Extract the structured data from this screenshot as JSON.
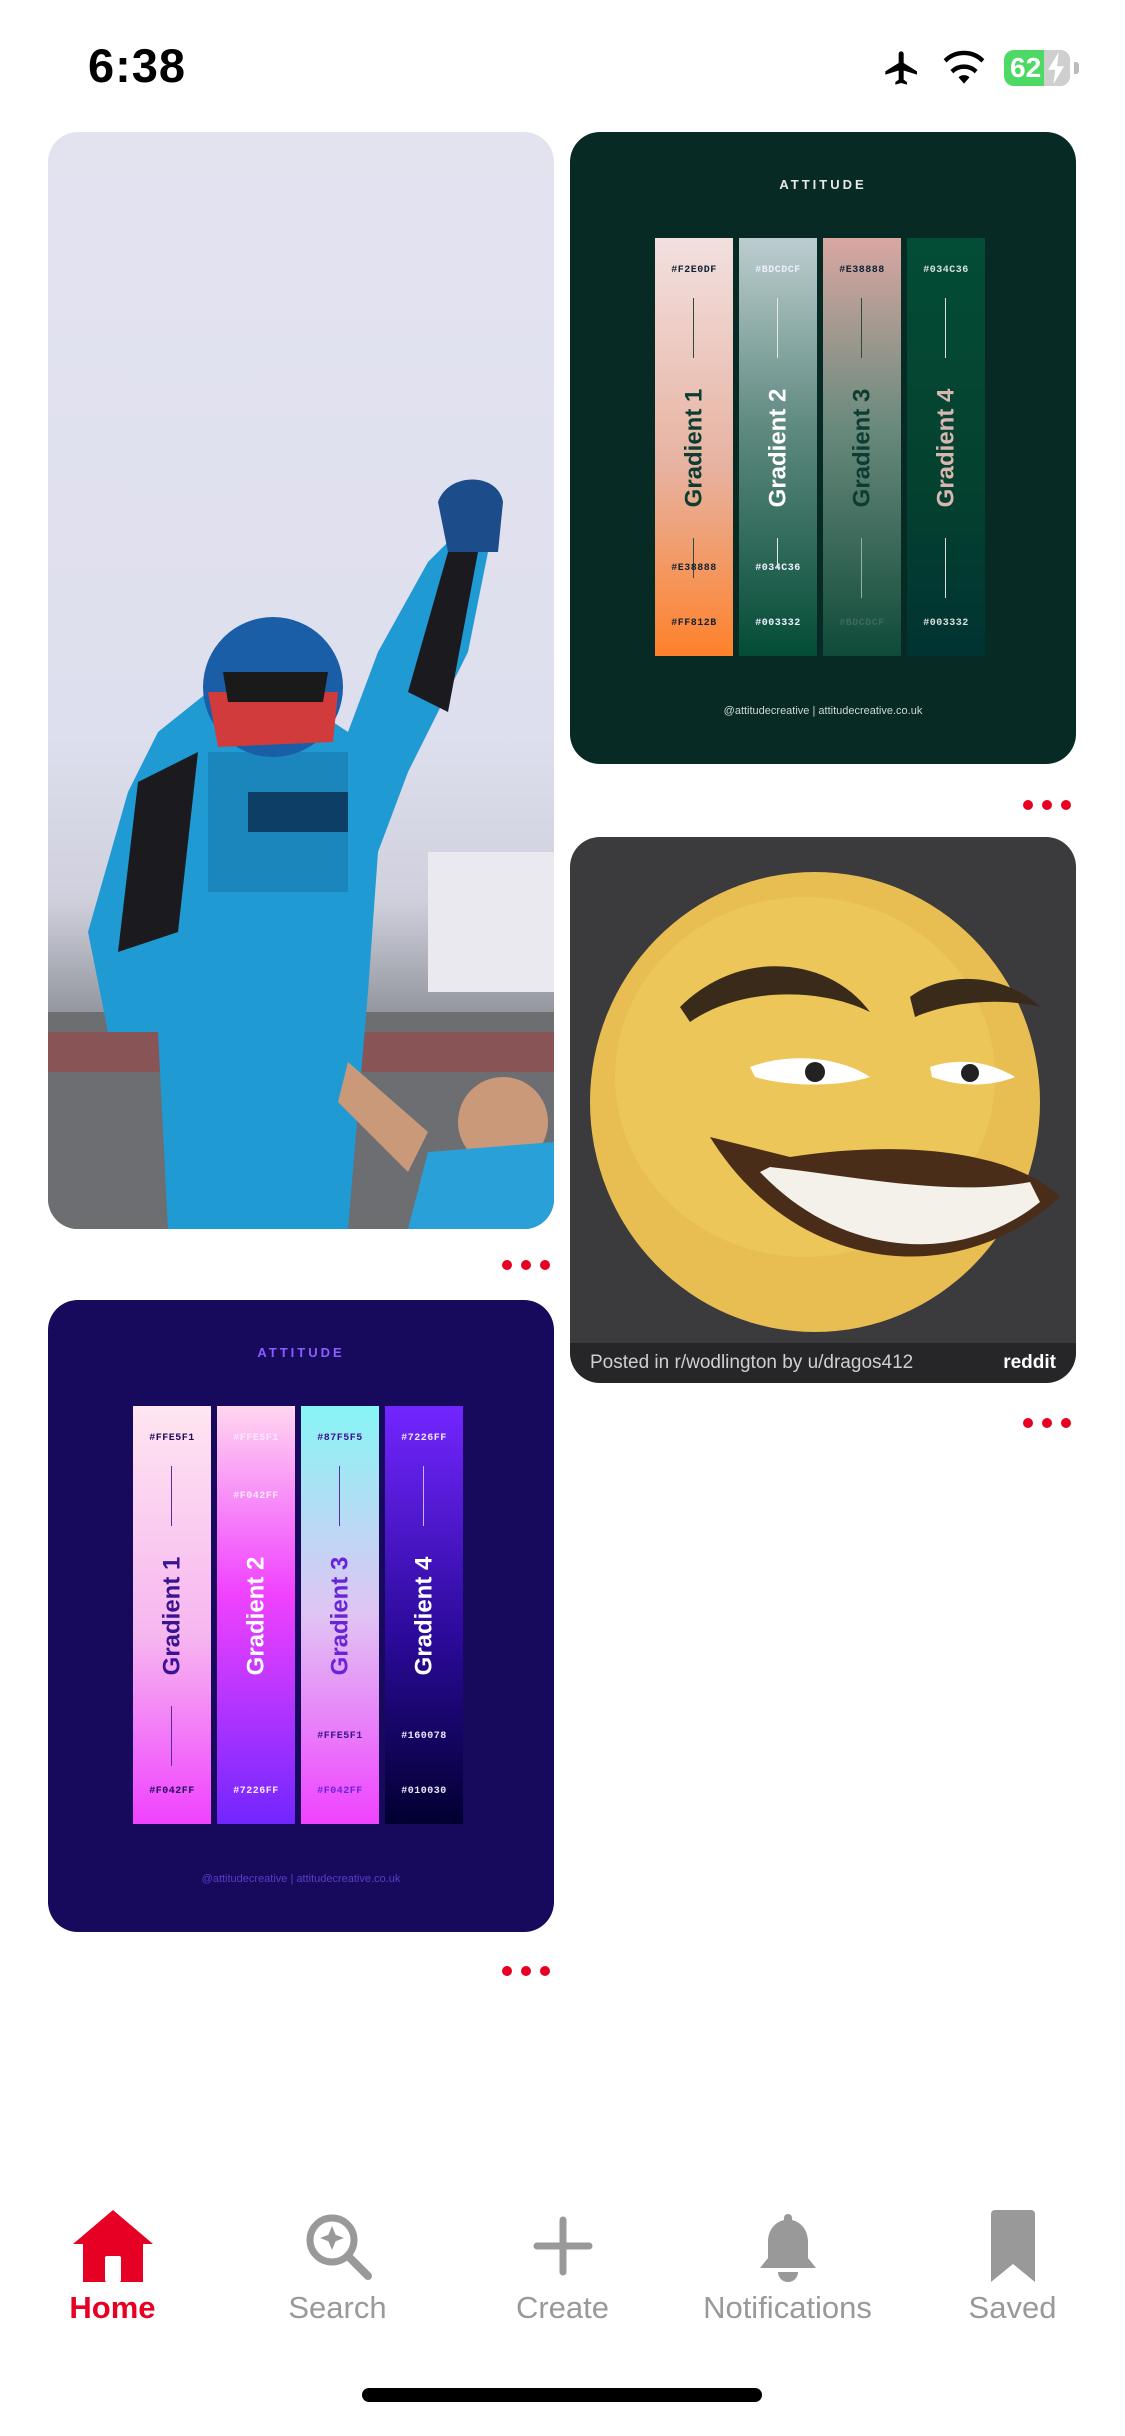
{
  "status_bar": {
    "time": "6:38",
    "battery": "62"
  },
  "pins": {
    "racer": {
      "alt": "Racing driver celebrating"
    },
    "palette_green": {
      "brand": "ATTITUDE",
      "footer": "@attitudecreative | attitudecreative.co.uk",
      "strips": [
        {
          "name": "Gradient 1",
          "top_hex": "#F2E0DF",
          "mid_hex": "#E38888",
          "bottom_hex": "#FF812B"
        },
        {
          "name": "Gradient 2",
          "top_hex": "#BDCDCF",
          "mid_hex": "#034C36",
          "bottom_hex": "#003332"
        },
        {
          "name": "Gradient 3",
          "top_hex": "#E38888",
          "mid_hex": "",
          "bottom_hex": "#BDCDCF"
        },
        {
          "name": "Gradient 4",
          "top_hex": "#034C36",
          "mid_hex": "",
          "bottom_hex": "#003332"
        }
      ]
    },
    "meme": {
      "caption_left": "Posted in r/wodlington by u/dragos412",
      "caption_right": "reddit"
    },
    "palette_purple": {
      "brand": "ATTITUDE",
      "footer": "@attitudecreative | attitudecreative.co.uk",
      "strips": [
        {
          "name": "Gradient 1",
          "top_hex": "#FFE5F1",
          "mid_hex": "",
          "bottom_hex": "#F042FF"
        },
        {
          "name": "Gradient 2",
          "top_hex": "#FFE5F1",
          "mid_hex": "#F042FF",
          "bottom_hex": "#7226FF"
        },
        {
          "name": "Gradient 3",
          "top_hex": "#87F5F5",
          "mid_hex": "#FFE5F1",
          "bottom_hex": "#F042FF"
        },
        {
          "name": "Gradient 4",
          "top_hex": "#7226FF",
          "mid_hex": "#160078",
          "bottom_hex": "#010030"
        }
      ]
    }
  },
  "tabbar": {
    "items": [
      {
        "label": "Home",
        "icon": "home-icon",
        "active": true
      },
      {
        "label": "Search",
        "icon": "search-icon",
        "active": false
      },
      {
        "label": "Create",
        "icon": "plus-icon",
        "active": false
      },
      {
        "label": "Notifications",
        "icon": "bell-icon",
        "active": false
      },
      {
        "label": "Saved",
        "icon": "bookmark-icon",
        "active": false
      }
    ]
  },
  "colors": {
    "accent": "#e60023",
    "inactive": "#999999"
  }
}
